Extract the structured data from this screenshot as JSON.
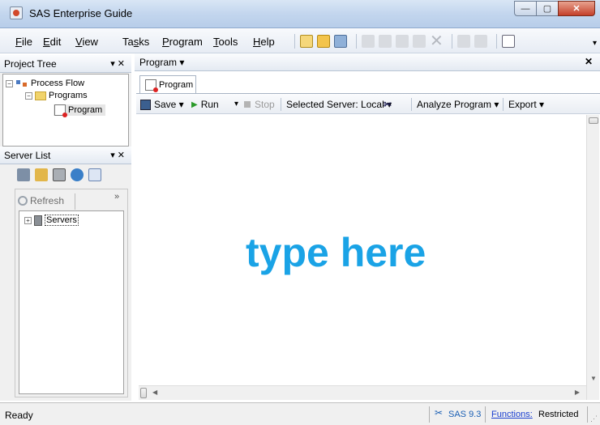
{
  "window": {
    "title": "SAS Enterprise Guide",
    "buttons": {
      "minimize": "—",
      "maximize": "▢",
      "close": "✕"
    }
  },
  "menubar": {
    "items": [
      {
        "label": "File",
        "mn": "F"
      },
      {
        "label": "Edit",
        "mn": "E"
      },
      {
        "label": "View",
        "mn": "V"
      },
      {
        "label": "Tasks",
        "mn": "s"
      },
      {
        "label": "Program",
        "mn": "P"
      },
      {
        "label": "Tools",
        "mn": "T"
      },
      {
        "label": "Help",
        "mn": "H"
      }
    ],
    "toolbar_icons": [
      "new-icon",
      "open-icon",
      "add-data-icon",
      "print-icon",
      "cut-icon",
      "copy-icon",
      "paste-icon",
      "delete-icon",
      "undo-icon",
      "redo-icon",
      "window-icon"
    ],
    "overflow": "▾"
  },
  "project_tree": {
    "header": "Project Tree",
    "controls": "▾  ✕",
    "nodes": [
      "Process Flow",
      "Programs",
      "Program"
    ]
  },
  "server_list": {
    "header": "Server List",
    "controls": "▾  ✕",
    "tool_icons": [
      "disconnect-icon",
      "library-icon",
      "server-icon",
      "globe-icon",
      "book-icon"
    ],
    "refresh": "Refresh",
    "overflow": "»",
    "nodes": [
      "Servers"
    ]
  },
  "editor": {
    "header": "Program ▾",
    "close": "✕",
    "tab": "Program",
    "toolbar": {
      "save": "Save ▾",
      "run": "Run",
      "run_arrow": "▾",
      "stop": "Stop",
      "server": "Selected Server: Local ▾",
      "analyze": "Analyze Program ▾",
      "export": "Export ▾"
    },
    "overlay": "type here"
  },
  "statusbar": {
    "ready": "Ready",
    "sas_version": "SAS 9.3",
    "functions_label": "Functions:",
    "functions_value": "Restricted"
  },
  "colors": {
    "overlay_text": "#1aa3e6",
    "run_green": "#2a9a2a",
    "link_blue": "#1a3fd0"
  }
}
